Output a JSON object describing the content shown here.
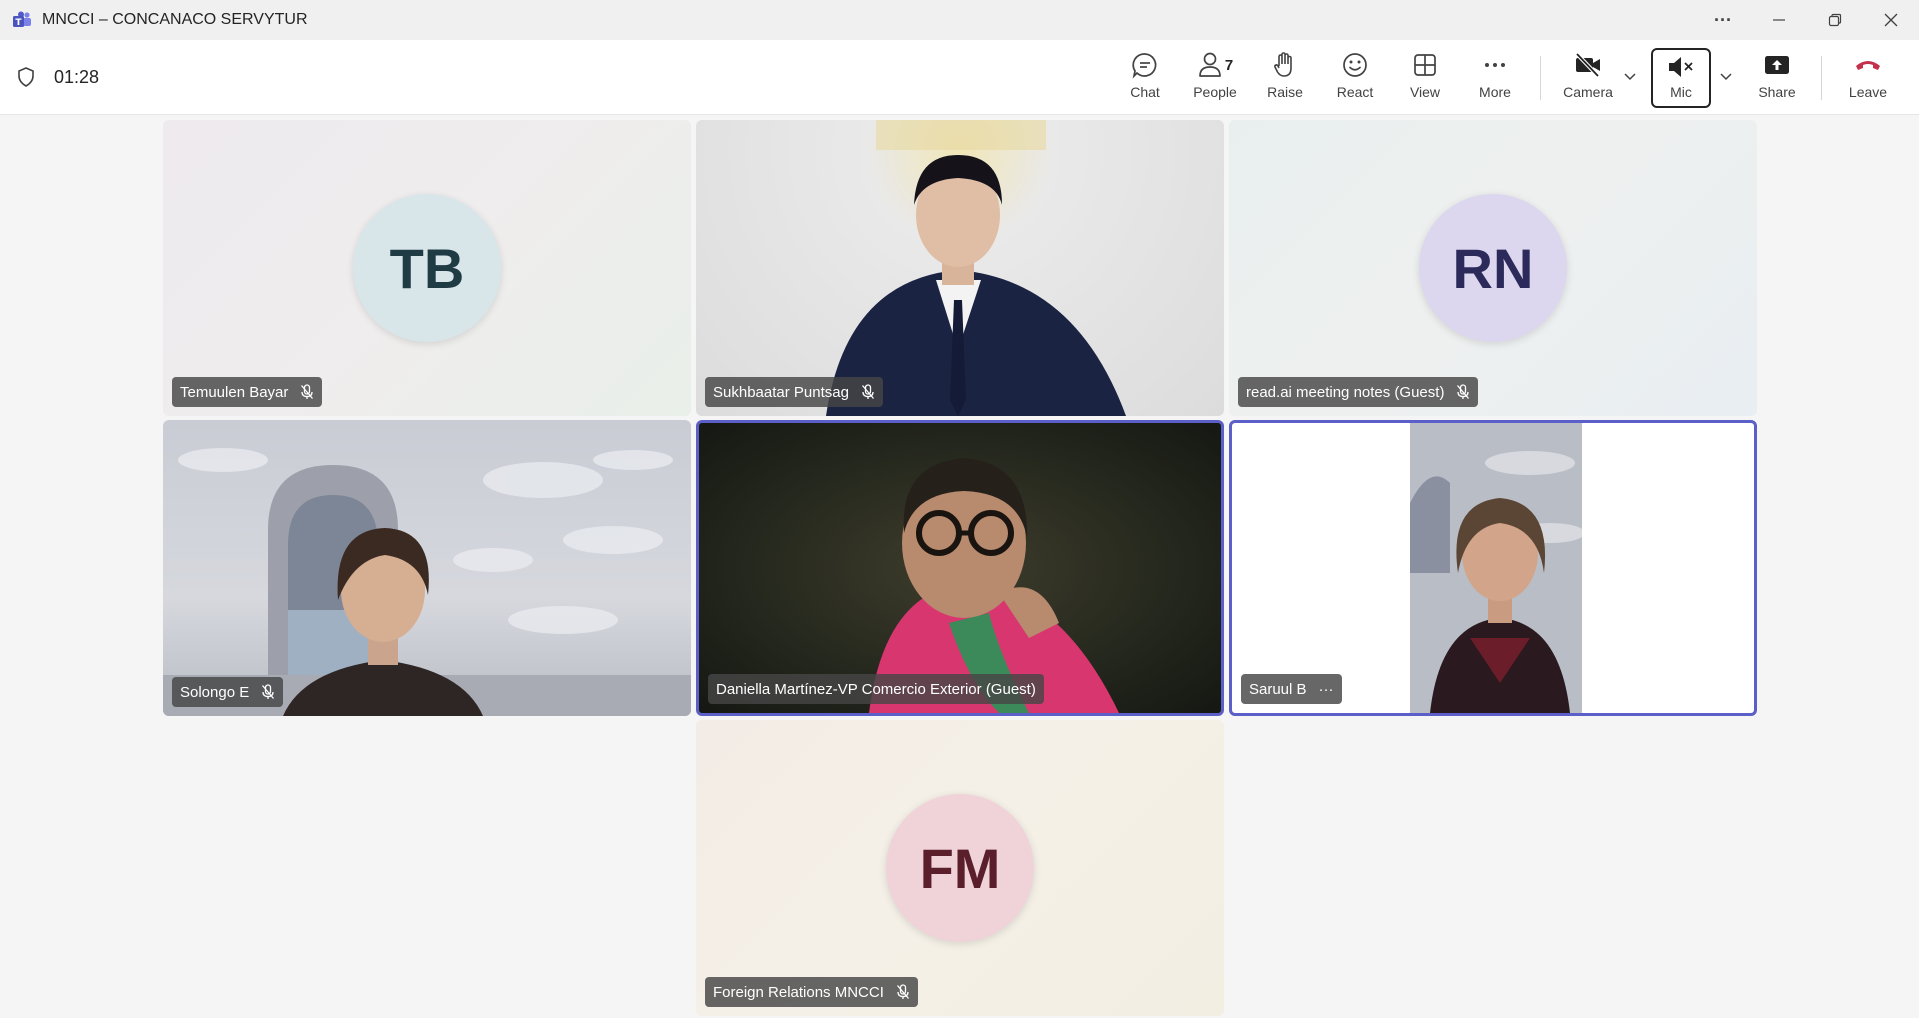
{
  "window": {
    "title": "MNCCI – CONCANACO SERVYTUR",
    "more_label": "···"
  },
  "toolbar": {
    "timer": "01:28",
    "buttons": {
      "chat": "Chat",
      "people": "People",
      "people_count": "7",
      "raise": "Raise",
      "react": "React",
      "view": "View",
      "more": "More",
      "camera": "Camera",
      "mic": "Mic",
      "share": "Share",
      "leave": "Leave"
    }
  },
  "participants": [
    {
      "name": "Temuulen Bayar",
      "initials": "TB",
      "video": false,
      "muted": true
    },
    {
      "name": "Sukhbaatar Puntsag",
      "video": true,
      "muted": true
    },
    {
      "name": "read.ai meeting notes (Guest)",
      "initials": "RN",
      "video": false,
      "muted": true
    },
    {
      "name": "Solongo E",
      "video": true,
      "muted": true
    },
    {
      "name": "Daniella Martínez-VP Comercio Exterior (Guest)",
      "video": true,
      "muted": false,
      "speaking": true
    },
    {
      "name": "Saruul B",
      "video": true,
      "muted": false,
      "speaking": true,
      "more_label": "···"
    },
    {
      "name": "Foreign Relations MNCCI",
      "initials": "FM",
      "video": false,
      "muted": true
    }
  ],
  "colors": {
    "speaking_border": "#5b5fc7",
    "leave_red": "#c4314b",
    "avatar_tb_bg": "#d8e6ea",
    "avatar_tb_fg": "#1f3b44",
    "avatar_rn_bg": "#dcd7ee",
    "avatar_rn_fg": "#2c2a5a",
    "avatar_fm_bg": "#efd3d8",
    "avatar_fm_fg": "#5a1f2b"
  }
}
